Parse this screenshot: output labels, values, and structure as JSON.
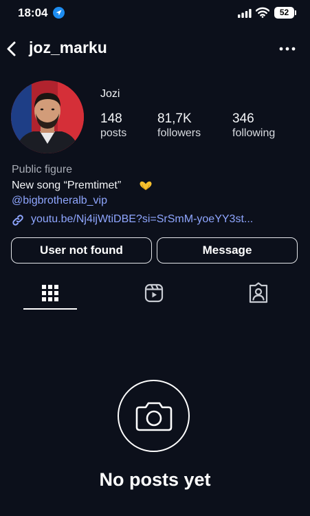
{
  "status_bar": {
    "time": "18:04",
    "battery": "52",
    "icons": [
      "location-arrow-icon",
      "cellular-signal-icon",
      "wifi-icon",
      "battery-icon"
    ]
  },
  "header": {
    "username": "joz_marku",
    "icons": [
      "chevron-left-icon",
      "more-dots-icon"
    ]
  },
  "profile": {
    "display_name": "Jozi",
    "stats": [
      {
        "value": "148",
        "label": "posts"
      },
      {
        "value": "81,7K",
        "label": "followers"
      },
      {
        "value": "346",
        "label": "following"
      }
    ],
    "category": "Public figure",
    "bio": "New song “Premtimet”",
    "bio_emoji": "heart-hands-emoji",
    "mention": "@bigbrotheralb_vip",
    "link": "youtu.be/Nj4ijWtiDBE?si=SrSmM-yoeYY3st..."
  },
  "buttons": {
    "primary": "User not found",
    "secondary": "Message"
  },
  "tabs": [
    {
      "icon": "grid-icon",
      "active": true
    },
    {
      "icon": "reels-icon",
      "active": false
    },
    {
      "icon": "tagged-icon",
      "active": false
    }
  ],
  "empty_state": {
    "icon": "camera-icon",
    "title": "No posts yet"
  },
  "colors": {
    "background": "#0c101b",
    "text": "#f3f5f7",
    "link": "#8fa6ff",
    "secondary_text": "#a8acb5",
    "accent_location": "#1d8cf0",
    "emoji": "#f6c02e"
  }
}
